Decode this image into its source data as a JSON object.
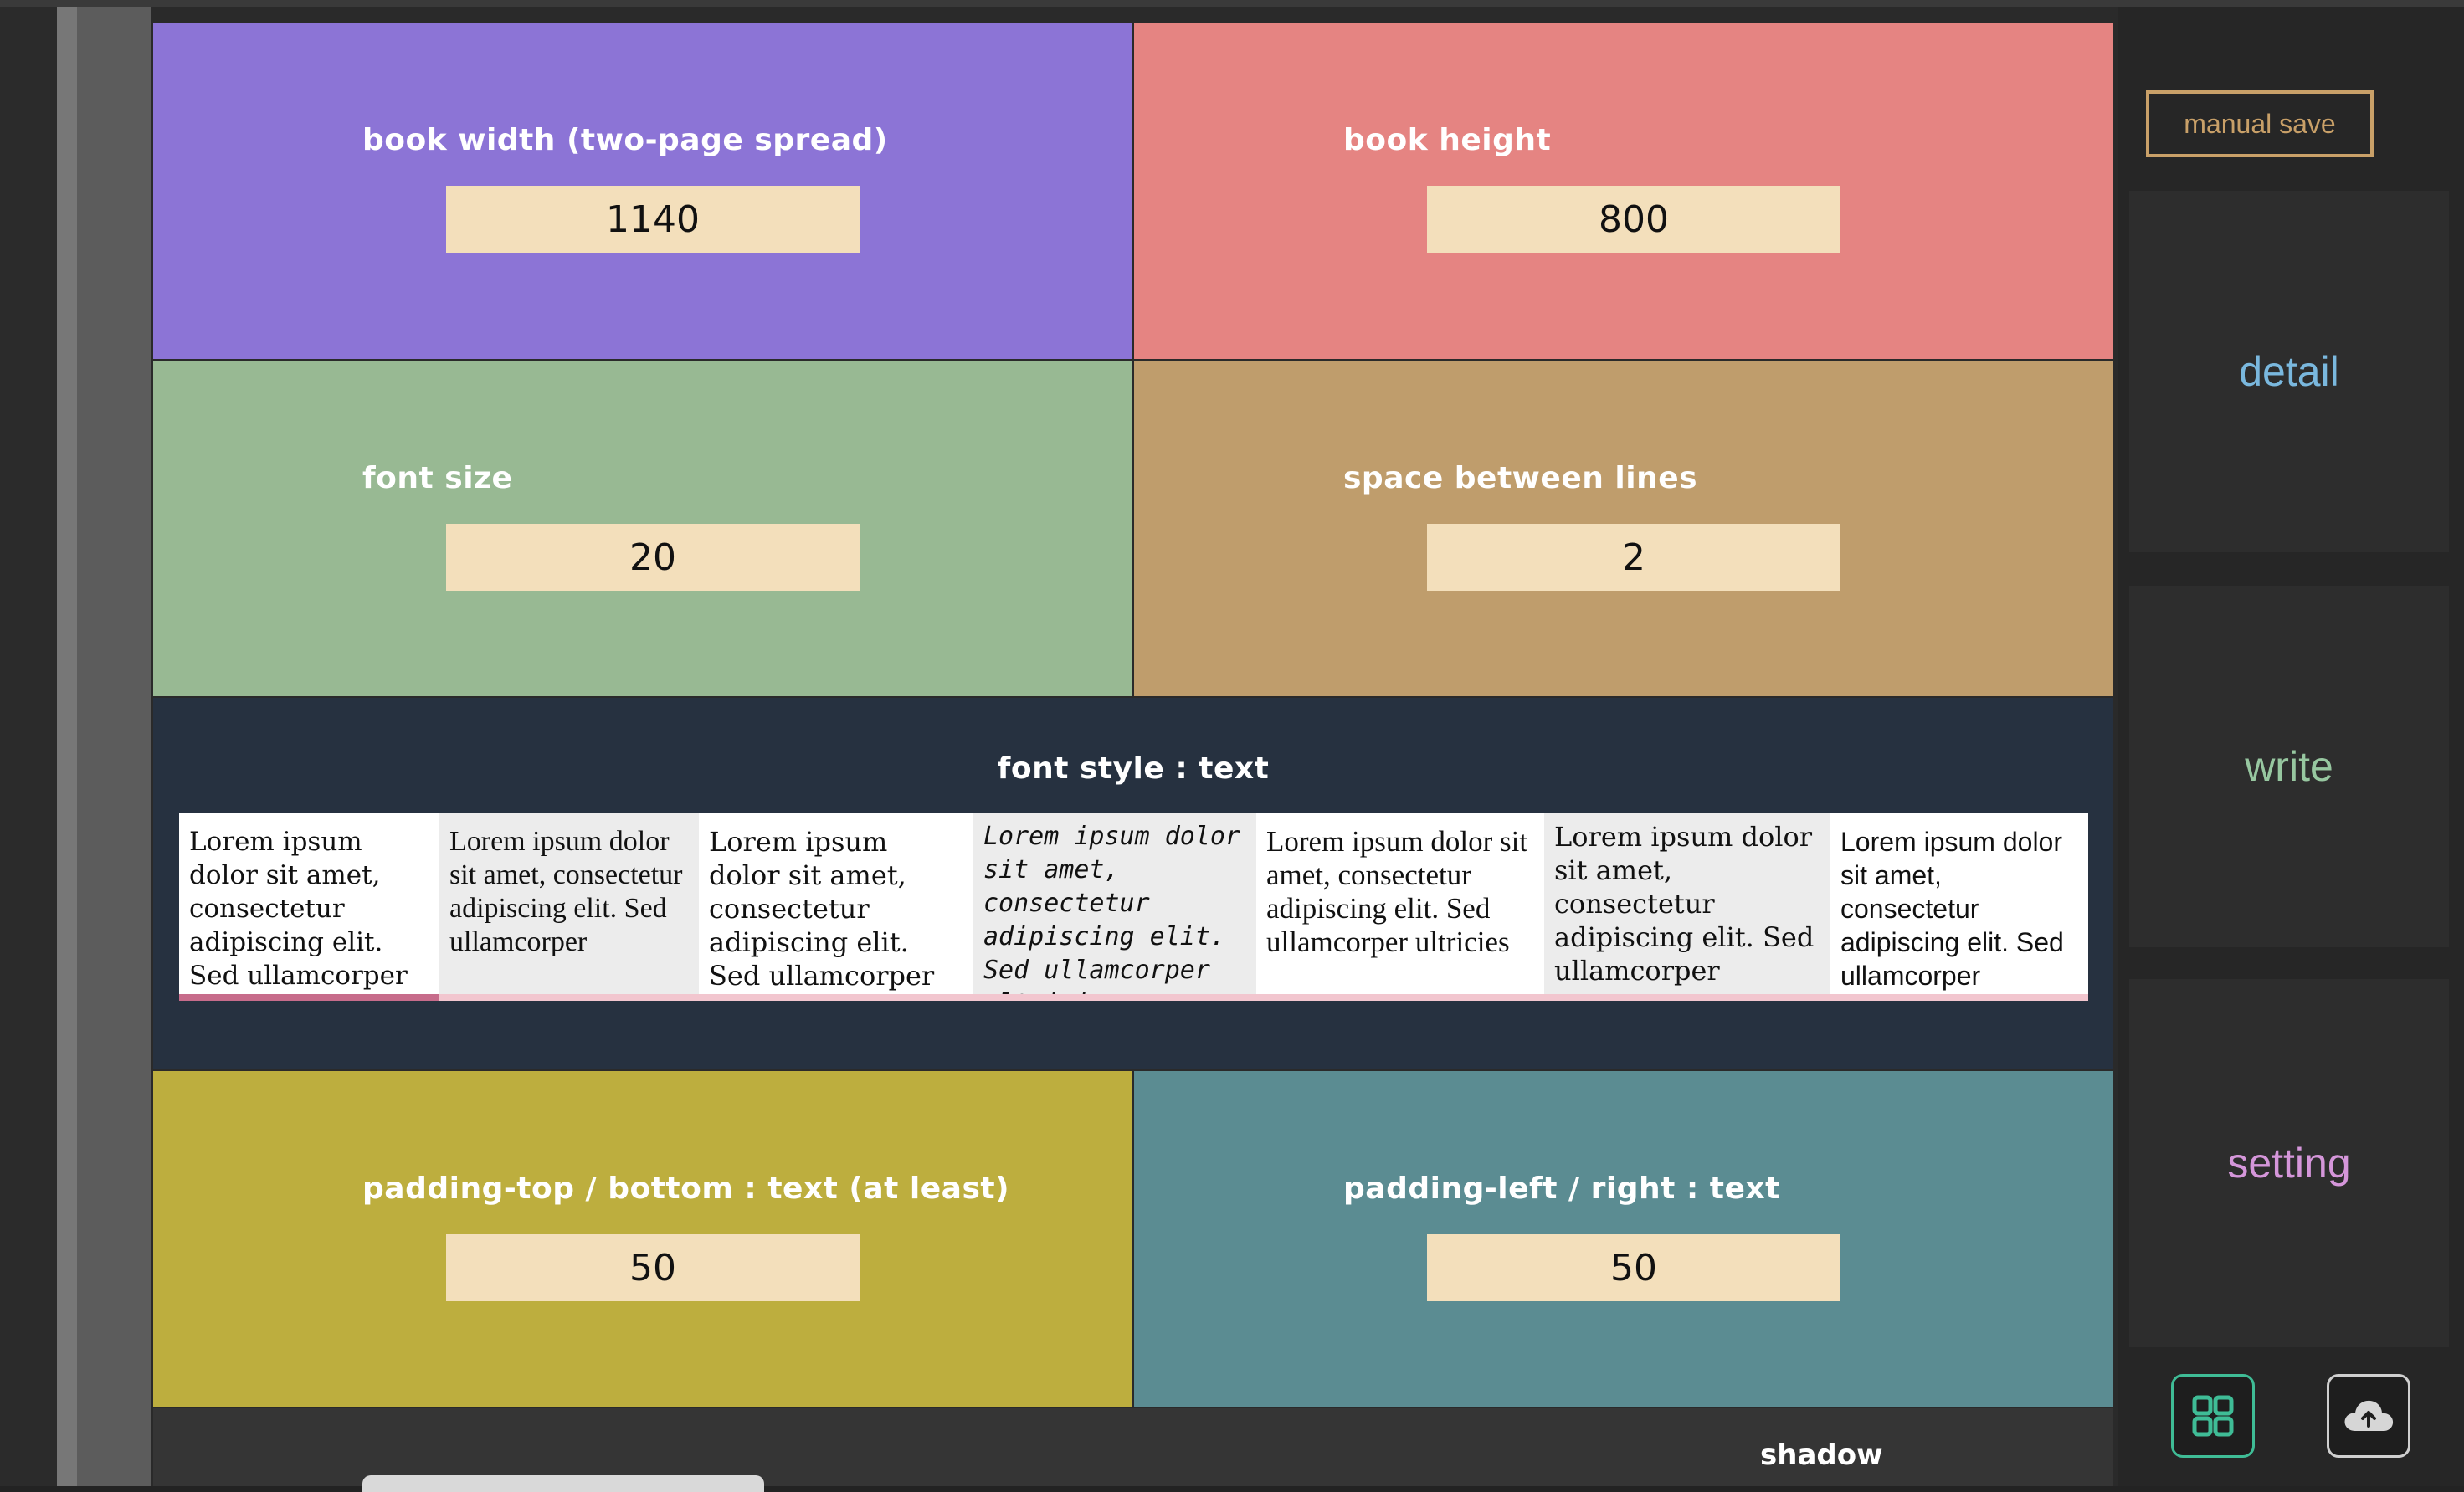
{
  "settings": {
    "book_width": {
      "label": "book width (two-page spread)",
      "value": "1140"
    },
    "book_height": {
      "label": "book height",
      "value": "800"
    },
    "font_size": {
      "label": "font size",
      "value": "20"
    },
    "line_space": {
      "label": "space between lines",
      "value": "2"
    },
    "padding_tb": {
      "label": "padding-top / bottom : text (at least)",
      "value": "50"
    },
    "padding_lr": {
      "label": "padding-left / right : text",
      "value": "50"
    }
  },
  "font_style": {
    "label": "font style : text",
    "samples": [
      "Lorem ipsum dolor sit amet, consectetur adipiscing elit. Sed ullamcorper",
      "Lorem ipsum dolor sit amet, consectetur adipiscing elit. Sed ullamcorper",
      "Lorem ipsum dolor sit amet, consectetur adipiscing elit. Sed ullamcorper",
      "Lorem ipsum dolor sit amet, consectetur adipiscing elit. Sed ullamcorper ultricies",
      "Lorem ipsum dolor sit amet, consectetur adipiscing elit. Sed ullamcorper ultricies",
      "Lorem ipsum dolor sit amet, consectetur adipiscing elit. Sed ullamcorper",
      "Lorem ipsum dolor sit amet, consectetur adipiscing elit. Sed ullamcorper"
    ]
  },
  "shadow": {
    "label": "shadow"
  },
  "sidebar": {
    "save_label": "manual save",
    "nav": [
      "detail",
      "write",
      "setting"
    ],
    "icons": [
      "grid-icon",
      "cloud-upload-icon"
    ]
  },
  "colors": {
    "book_width": "#8c74d6",
    "book_height": "#e58482",
    "font_size": "#98b993",
    "line_space": "#bf9d6c",
    "padding_tb": "#bdae3e",
    "padding_lr": "#5b8c92",
    "detail": "#7ab8de",
    "write": "#97c7a0",
    "setting": "#d596da",
    "save": "#c9a068",
    "grid_icon": "#3fbc96"
  }
}
